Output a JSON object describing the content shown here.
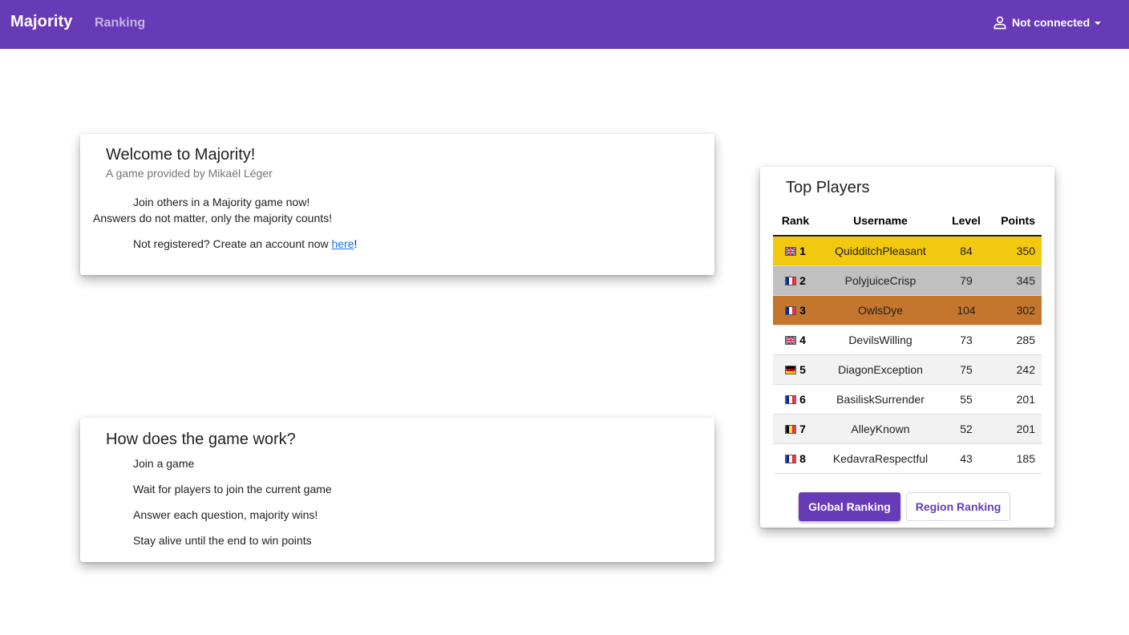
{
  "nav": {
    "brand": "Majority",
    "ranking_link": "Ranking",
    "user_menu_label": "Not connected",
    "user_icon": "person-icon"
  },
  "welcome": {
    "title": "Welcome to Majority!",
    "subtitle": "A game provided by Mikaël Léger",
    "line1": "Join others in a Majority game now!",
    "line2": "Answers do not matter, only the majority counts!",
    "register_prefix": "Not registered? Create an account now ",
    "register_link": "here",
    "register_suffix": "!"
  },
  "how": {
    "title": "How does the game work?",
    "steps": [
      "Join a game",
      "Wait for players to join the current game",
      "Answer each question, majority wins!",
      "Stay alive until the end to win points"
    ]
  },
  "top_players": {
    "title": "Top Players",
    "columns": [
      "Rank",
      "Username",
      "Level",
      "Points"
    ],
    "rows": [
      {
        "flag": "uk-flag",
        "rank": "1",
        "username": "QuidditchPleasant",
        "level": "84",
        "points": "350"
      },
      {
        "flag": "fr-flag",
        "rank": "2",
        "username": "PolyjuiceCrisp",
        "level": "79",
        "points": "345"
      },
      {
        "flag": "fr-flag",
        "rank": "3",
        "username": "OwlsDye",
        "level": "104",
        "points": "302"
      },
      {
        "flag": "uk-flag",
        "rank": "4",
        "username": "DevilsWilling",
        "level": "73",
        "points": "285"
      },
      {
        "flag": "de-flag",
        "rank": "5",
        "username": "DiagonException",
        "level": "75",
        "points": "242"
      },
      {
        "flag": "fr-flag",
        "rank": "6",
        "username": "BasiliskSurrender",
        "level": "55",
        "points": "201"
      },
      {
        "flag": "be-flag",
        "rank": "7",
        "username": "AlleyKnown",
        "level": "52",
        "points": "201"
      },
      {
        "flag": "fr-flag",
        "rank": "8",
        "username": "KedavraRespectful",
        "level": "43",
        "points": "185"
      }
    ],
    "global_button": "Global Ranking",
    "region_button": "Region Ranking"
  },
  "colors": {
    "primary": "#673ab7",
    "gold": "#f2c90f",
    "silver": "#c0c0c0",
    "bronze": "#c4762f",
    "link": "#1a73e8"
  }
}
